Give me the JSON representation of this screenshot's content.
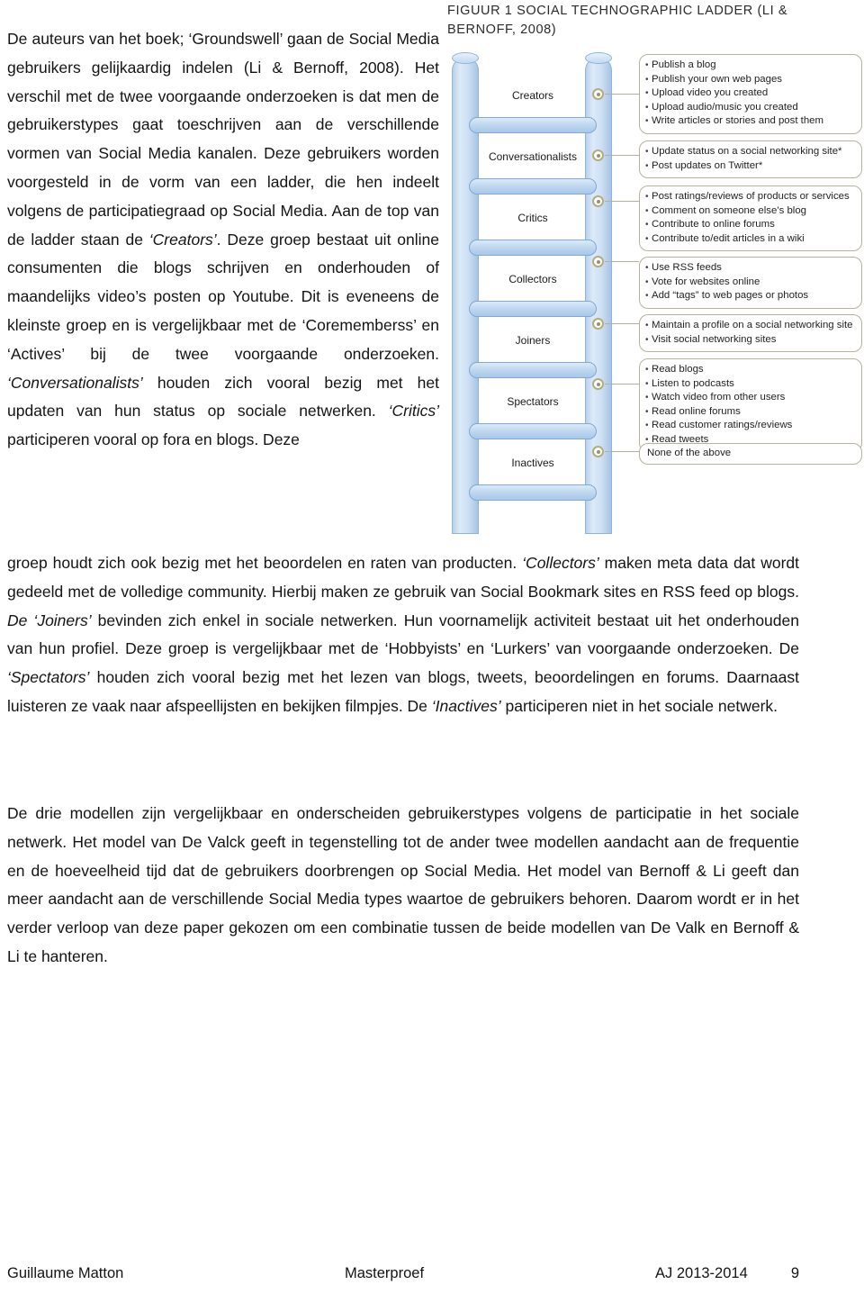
{
  "figure": {
    "caption": "FIGUUR 1 SOCIAL TECHNOGRAPHIC LADDER (LI & BERNOFF, 2008)",
    "rungs": [
      {
        "label": "Creators"
      },
      {
        "label": "Conversationalists"
      },
      {
        "label": "Critics"
      },
      {
        "label": "Collectors"
      },
      {
        "label": "Joiners"
      },
      {
        "label": "Spectators"
      },
      {
        "label": "Inactives"
      }
    ],
    "boxes": [
      {
        "for": "Creators",
        "items": [
          "Publish a blog",
          "Publish your own web pages",
          "Upload video you created",
          "Upload audio/music you created",
          "Write articles or stories and post them"
        ]
      },
      {
        "for": "Conversationalists",
        "items": [
          "Update status on a social networking site*",
          "Post updates on Twitter*"
        ]
      },
      {
        "for": "Critics",
        "items": [
          "Post ratings/reviews of products or services",
          "Comment on someone else’s blog",
          "Contribute to online forums",
          "Contribute to/edit articles in a wiki"
        ]
      },
      {
        "for": "Collectors",
        "items": [
          "Use RSS feeds",
          "Vote for websites online",
          "Add “tags” to web pages or photos"
        ]
      },
      {
        "for": "Joiners",
        "items": [
          "Maintain a profile on a social networking site",
          "Visit social networking sites"
        ]
      },
      {
        "for": "Spectators",
        "items": [
          "Read blogs",
          "Listen to podcasts",
          "Watch video from other users",
          "Read online forums",
          "Read customer ratings/reviews",
          "Read tweets"
        ]
      },
      {
        "for": "Inactives",
        "plain": "None of the above",
        "items": []
      }
    ],
    "colors": {
      "rail": "#c5d9ef",
      "rail_border": "#8fb4dc",
      "connector": "#b3ac7e",
      "box_border": "#b7b29c"
    }
  },
  "body": {
    "paragraph1_column": "De auteurs van het boek; ‘Groundswell’ gaan de Social Media gebruikers gelijkaardig indelen (Li & Bernoff, 2008). Het verschil met de twee voorgaande onderzoeken is dat men de gebruikerstypes gaat toeschrijven aan de verschillende vormen van Social Media kanalen. Deze gebruikers worden voorgesteld in de vorm van een ladder, die hen indeelt volgens de participatiegraad op Social Media. Aan de top van de ladder staan de ",
    "creators_italic": "‘Creators’",
    "paragraph1_column_b": ". Deze groep bestaat uit online consumenten die blogs schrijven en onderhouden of maandelijks video’s posten op Youtube. Dit is eveneens de kleinste groep en is vergelijkbaar met de ‘Corememberss’ en ‘Actives’ bij de twee voorgaande onderzoeken. ",
    "conversationalists_italic": "‘Conversationalists’",
    "paragraph1_column_c": " houden zich vooral bezig met het updaten van hun status op sociale netwerken. ",
    "critics_italic_c": "‘C",
    "critics_italic_rest": "ritics’",
    "paragraph1_column_d": " participeren vooral op fora en blogs. Deze",
    "paragraph1_full": "groep houdt zich ook bezig met het beoordelen en raten van producten. ",
    "collectors_italic": "‘Collectors’",
    "paragraph1_full_b": " maken meta data dat wordt gedeeld met de volledige community. Hierbij maken ze gebruik van Social Bookmark sites en RSS feed op blogs. ",
    "joiners_italic": "De ‘Joiners’",
    "paragraph1_full_c": " bevinden zich enkel in sociale netwerken. Hun voornamelijk activiteit bestaat uit het onderhouden van hun profiel. Deze groep is vergelijkbaar met de ‘Hobbyists’ en ‘Lurkers’ van voorgaande onderzoeken. De ",
    "spectators_italic": "‘Spectators’",
    "paragraph1_full_d": " houden zich vooral bezig met het lezen van blogs, tweets, beoordelingen en forums. Daarnaast luisteren ze vaak naar afspeellijsten en bekijken filmpjes. De ",
    "inactives_italic": "‘Inactives’",
    "paragraph1_full_e": " participeren niet in het sociale netwerk.",
    "paragraph2": "De drie modellen zijn vergelijkbaar en onderscheiden gebruikerstypes volgens de participatie in het sociale netwerk. Het model van De Valck geeft in tegenstelling tot de ander twee modellen aandacht aan de frequentie en de hoeveelheid tijd dat de gebruikers doorbrengen op Social Media. Het model van Bernoff & Li geeft dan meer aandacht aan de verschillende Social Media types waartoe de gebruikers behoren. Daarom wordt er in het verder verloop van deze paper gekozen om een combinatie tussen de beide modellen van De Valk en Bernoff & Li te hanteren."
  },
  "footer": {
    "author": "Guillaume Matton",
    "document_type": "Masterproef",
    "academic_year": "AJ 2013-2014",
    "page_number": "9"
  }
}
